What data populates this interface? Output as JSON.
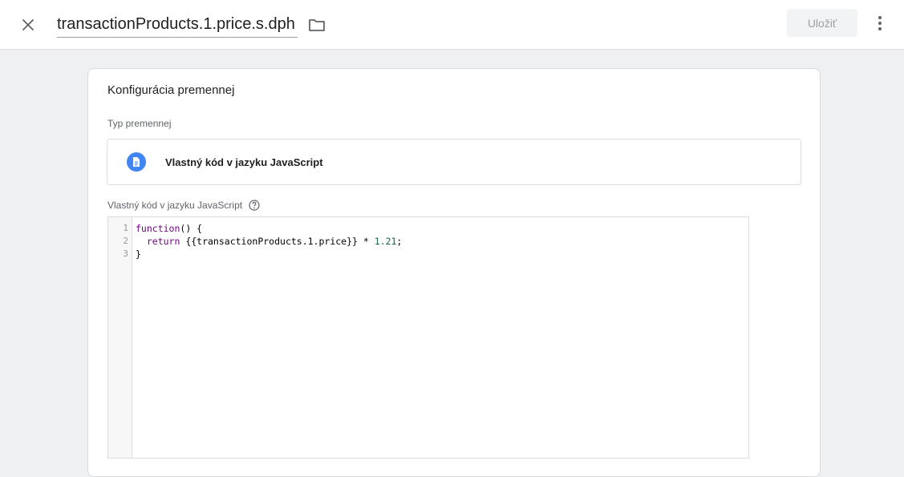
{
  "header": {
    "title_value": "transactionProducts.1.price.s.dph",
    "save_label": "Uložiť"
  },
  "card": {
    "title": "Konfigurácia premennej",
    "type_label": "Typ premennej",
    "type_name": "Vlastný kód v jazyku JavaScript",
    "code_label": "Vlastný kód v jazyku JavaScript"
  },
  "editor": {
    "line_numbers": [
      "1",
      "2",
      "3"
    ],
    "line1_kw": "function",
    "line1_rest": "() {",
    "line2_kw": "  return",
    "line2_var": " {{transactionProducts.1.price}} * ",
    "line2_num": "1.21",
    "line2_end": ";",
    "line3": "}"
  },
  "icons": {
    "close": "close-icon",
    "folder": "folder-icon",
    "more": "more-vert-icon",
    "type": "document-icon",
    "help": "help-icon"
  },
  "colors": {
    "accent_blue": "#4285f4",
    "page_bg": "#eff0f1"
  }
}
